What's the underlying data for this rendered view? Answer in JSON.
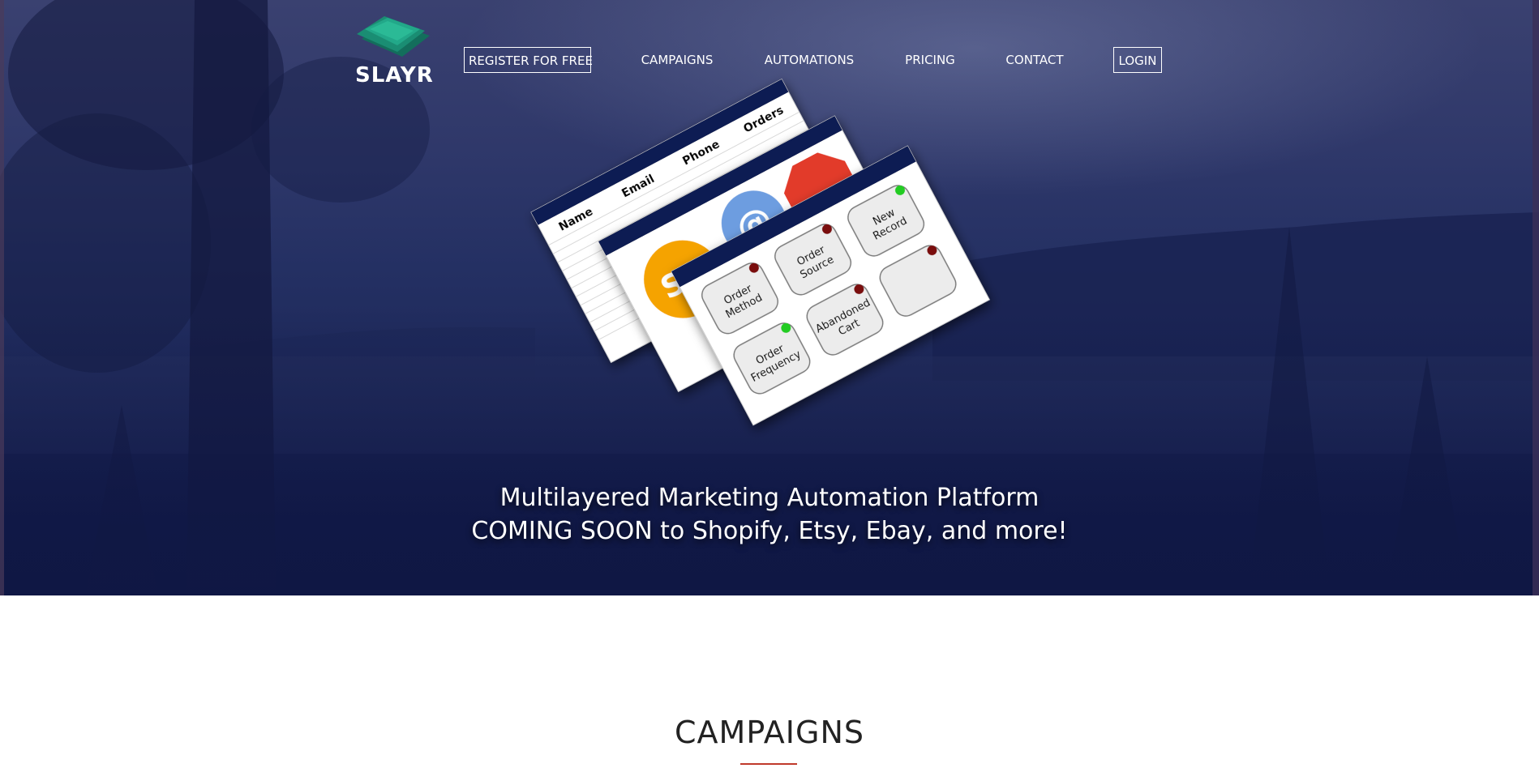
{
  "brand": {
    "name": "SLAYR"
  },
  "nav": {
    "items": [
      {
        "label": "REGISTER FOR FREE",
        "boxed": true
      },
      {
        "label": "CAMPAIGNS",
        "boxed": false
      },
      {
        "label": "AUTOMATIONS",
        "boxed": false
      },
      {
        "label": "PRICING",
        "boxed": false
      },
      {
        "label": "CONTACT",
        "boxed": false
      },
      {
        "label": "LOGIN",
        "boxed": true
      }
    ]
  },
  "illustration": {
    "table_headers": [
      "Name",
      "Email",
      "Phone",
      "Orders"
    ],
    "channel_icons": [
      "SMS",
      "@"
    ],
    "nodes": [
      {
        "label_lines": [
          "Order",
          "Method"
        ],
        "status": "red"
      },
      {
        "label_lines": [
          "Order",
          "Source"
        ],
        "status": "red"
      },
      {
        "label_lines": [
          "New",
          "Record"
        ],
        "status": "green"
      },
      {
        "label_lines": [
          "Order",
          "Frequency"
        ],
        "status": "green"
      },
      {
        "label_lines": [
          "Abandoned",
          "Cart"
        ],
        "status": "red"
      },
      {
        "label_lines": [],
        "status": "red"
      }
    ]
  },
  "hero": {
    "line1": "Multilayered Marketing Automation Platform",
    "line2": "COMING SOON to Shopify, Etsy, Ebay, and more!"
  },
  "section": {
    "title": "CAMPAIGNS"
  },
  "colors": {
    "accent_green": "#1fa38a",
    "status_red": "#7a0b0b",
    "status_green": "#22cc22",
    "rule_red": "#c0392b",
    "navy": "#0f1744"
  }
}
